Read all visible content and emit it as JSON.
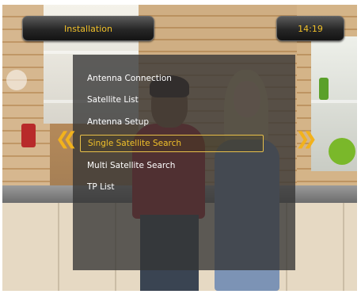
{
  "header": {
    "title": "Installation",
    "clock": "14:19"
  },
  "menu": {
    "items": [
      {
        "label": "Antenna Connection"
      },
      {
        "label": "Satellite List"
      },
      {
        "label": "Antenna Setup"
      },
      {
        "label": "Single Satellite Search",
        "selected": true
      },
      {
        "label": "Multi Satellite Search"
      },
      {
        "label": "TP List"
      }
    ],
    "selected_index": 3
  },
  "colors": {
    "accent": "#f0c02a",
    "text": "#ffffff",
    "panel": "#343434",
    "arrow": "#f2b21c"
  },
  "icons": {
    "left_arrow": "double-chevron-left-icon",
    "right_arrow": "double-chevron-right-icon"
  }
}
